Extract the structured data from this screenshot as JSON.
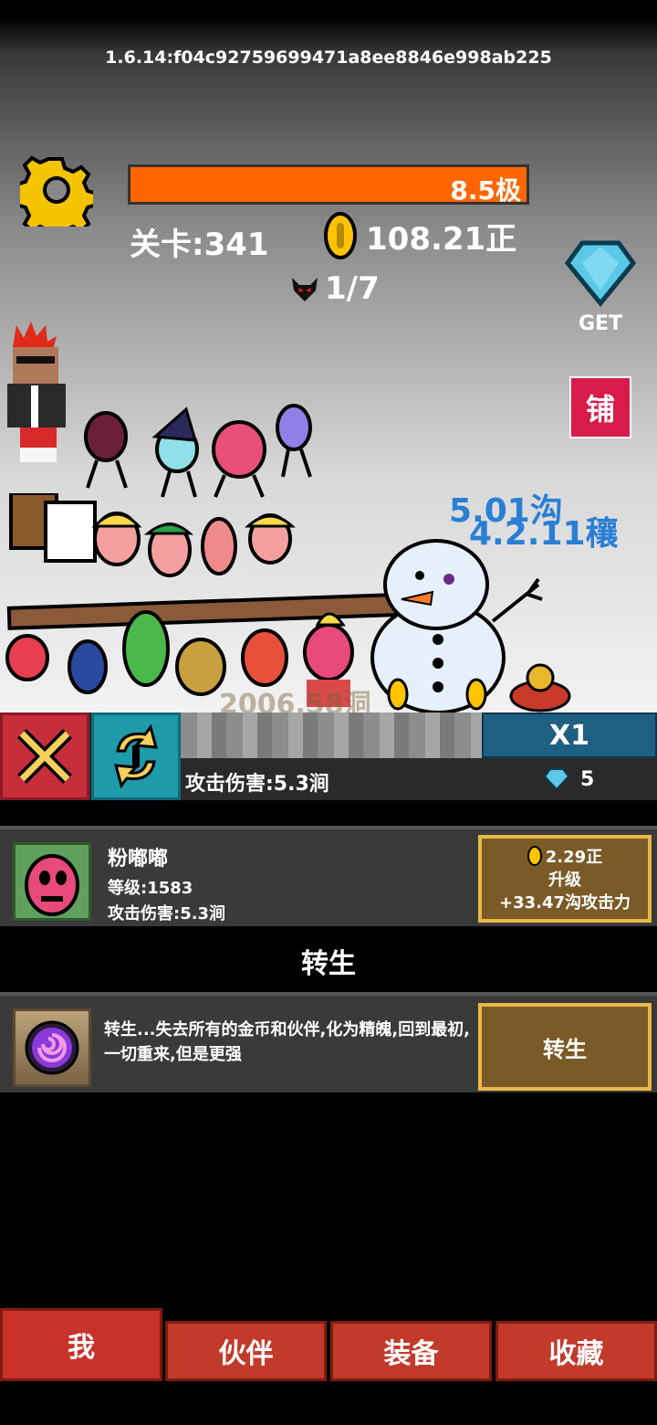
{
  "version": "1.6.14:f04c92759699471a8ee8846e998ab225",
  "boss_hp": {
    "text": "8.5极",
    "fraction": 1.0
  },
  "stage": "关卡:341",
  "coins": "108.21正",
  "wave": "1/7",
  "gem_button": {
    "label": "GET"
  },
  "shop_button": {
    "label": "铺"
  },
  "floating_damage": [
    "5.01沟",
    "4.2.11穰"
  ],
  "ghost_damage": "2006.58洞",
  "controls": {
    "multiplier": "X1",
    "attack_damage": "攻击伤害:5.3涧",
    "gems": "5"
  },
  "hero": {
    "name": "粉嘟嘟",
    "level": "等级:1583",
    "attack": "攻击伤害:5.3涧",
    "upgrade": {
      "cost": "2.29正",
      "label": "升级",
      "bonus": "+33.47沟攻击力"
    }
  },
  "rebirth_section": {
    "title": "转生",
    "description": "转生...失去所有的金币和伙伴,化为精魄,回到最初,一切重来,但是更强",
    "button": "转生"
  },
  "tabs": [
    {
      "label": "我",
      "active": true
    },
    {
      "label": "伙伴",
      "active": false
    },
    {
      "label": "装备",
      "active": false
    },
    {
      "label": "收藏",
      "active": false
    }
  ],
  "colors": {
    "hp_bar": "#ff6600",
    "tab": "#c23a2a",
    "button_border": "#e8b84a"
  }
}
